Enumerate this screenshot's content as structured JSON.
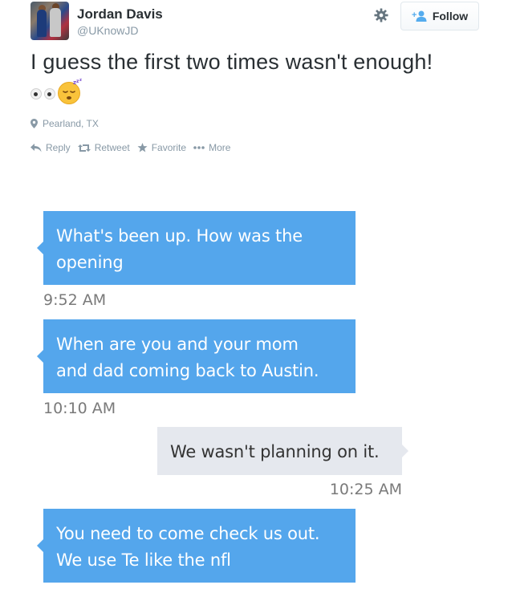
{
  "tweet": {
    "display_name": "Jordan Davis",
    "screen_name": "@UKnowJD",
    "follow_label": "Follow",
    "text": "I guess the first two times wasn't enough!",
    "emoji": [
      "eyes",
      "sleeping-face"
    ],
    "location": "Pearland, TX",
    "actions": {
      "reply": "Reply",
      "retweet": "Retweet",
      "favorite": "Favorite",
      "more": "More"
    }
  },
  "messages": [
    {
      "direction": "incoming",
      "text_line1": "What's been up.  How was the",
      "text_line2": "opening",
      "time": "9:52 AM"
    },
    {
      "direction": "incoming",
      "text_line1": "When are you and your mom",
      "text_line2": "and dad coming back to Austin.",
      "time": "10:10 AM"
    },
    {
      "direction": "outgoing",
      "text_line1": "We wasn't planning on it.",
      "time": "10:25 AM"
    },
    {
      "direction": "incoming",
      "text_line1": "You need to come check us out.",
      "text_line2": "We use Te like the nfl"
    }
  ],
  "colors": {
    "incoming_bubble": "#54a6ec",
    "outgoing_bubble": "#e5e8ee",
    "muted_text": "#8899a6",
    "follow_icon": "#55acee"
  }
}
